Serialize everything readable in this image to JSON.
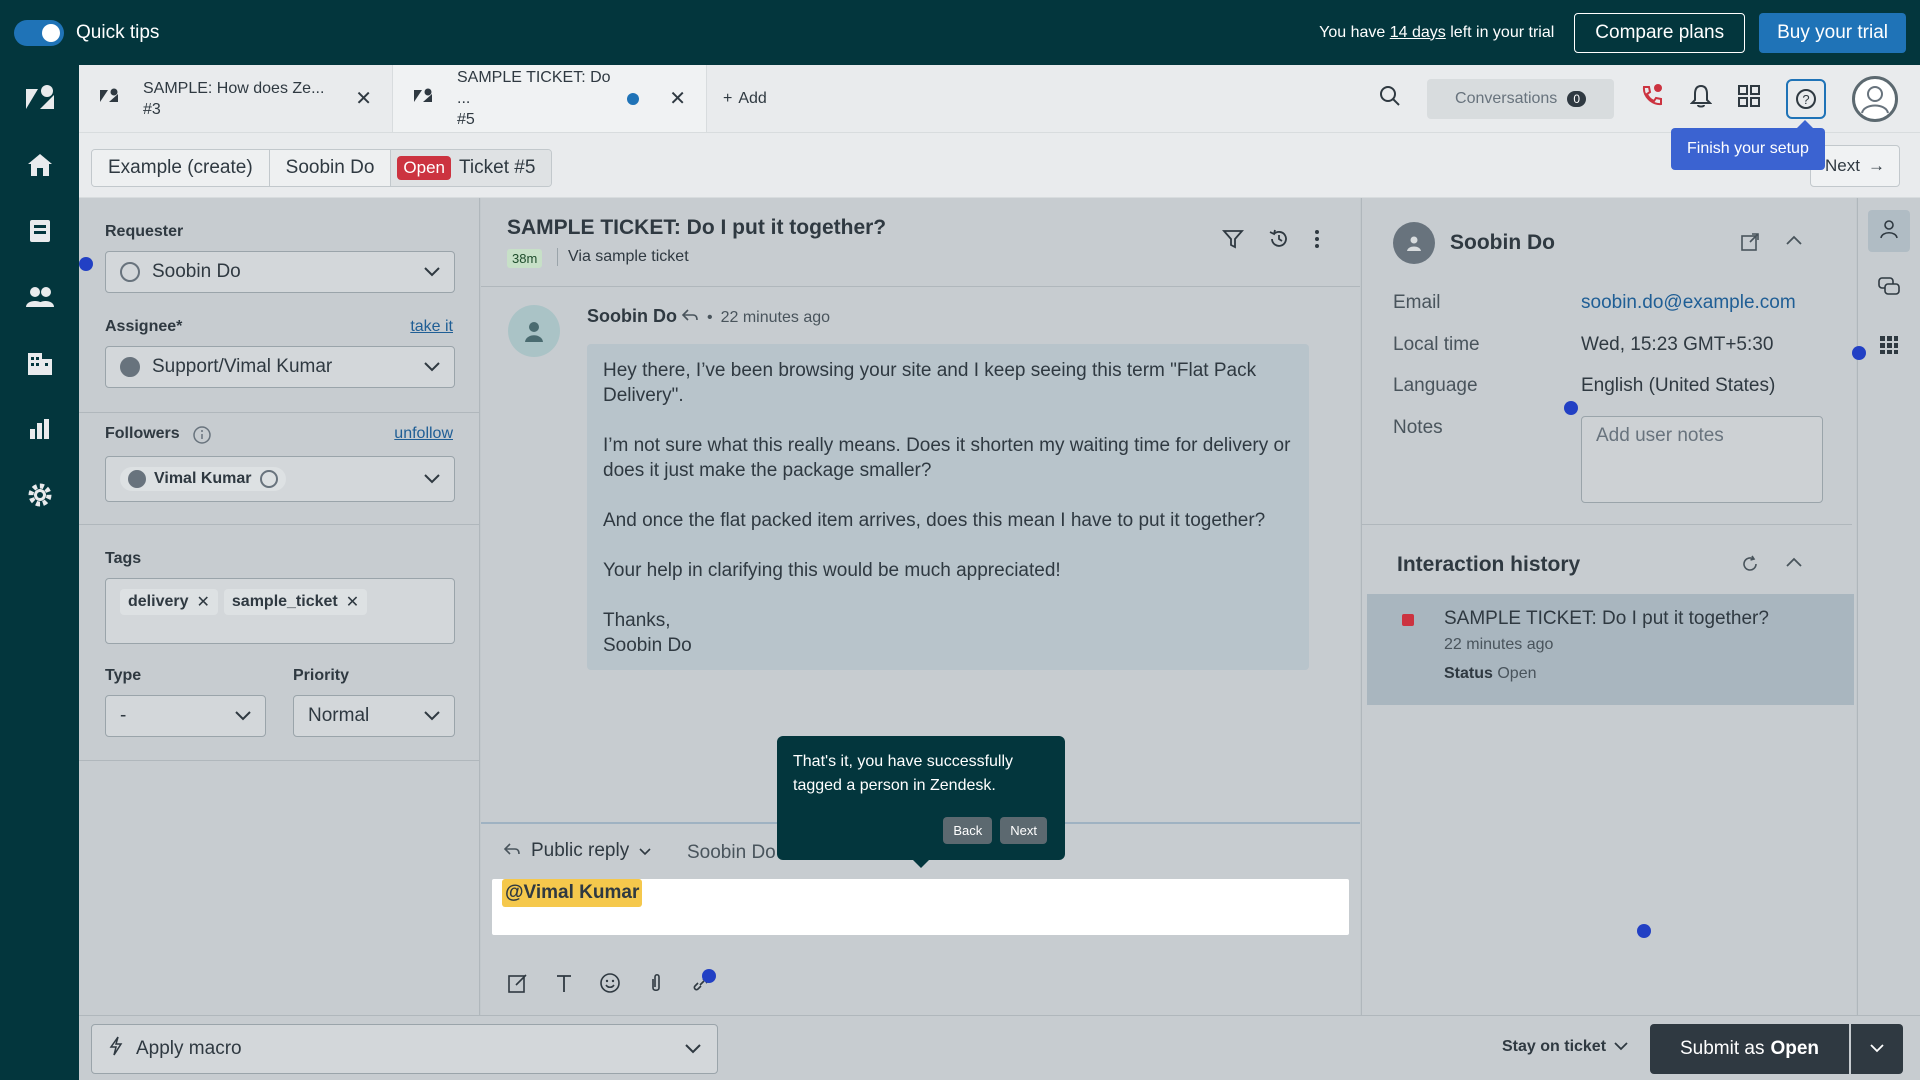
{
  "topbar": {
    "quick_tips": "Quick tips",
    "trial_prefix": "You have ",
    "trial_days": "14 days",
    "trial_suffix": " left in your trial",
    "compare_plans": "Compare plans",
    "buy_trial": "Buy your trial"
  },
  "tabs": [
    {
      "title": "SAMPLE: How does Ze...",
      "number": "#3"
    },
    {
      "title": "SAMPLE TICKET: Do ...",
      "number": "#5"
    }
  ],
  "add_tab": "Add",
  "conversations": {
    "label": "Conversations",
    "count": "0"
  },
  "finish_setup": "Finish your setup",
  "breadcrumb": {
    "item1": "Example (create)",
    "item2": "Soobin Do",
    "status": "Open",
    "ticket": "Ticket #5"
  },
  "next_label": "Next",
  "properties": {
    "requester_label": "Requester",
    "requester_value": "Soobin Do",
    "assignee_label": "Assignee*",
    "take_it": "take it",
    "assignee_value": "Support/Vimal Kumar",
    "followers_label": "Followers",
    "unfollow": "unfollow",
    "follower": "Vimal Kumar",
    "tags_label": "Tags",
    "tags": [
      "delivery",
      "sample_ticket"
    ],
    "type_label": "Type",
    "type_value": "-",
    "priority_label": "Priority",
    "priority_value": "Normal"
  },
  "conversation": {
    "title": "SAMPLE TICKET: Do I put it together?",
    "age": "38m",
    "via": "Via sample ticket",
    "author": "Soobin Do",
    "time": "22 minutes ago",
    "paragraphs": [
      "Hey there, I’ve been browsing your site and I keep seeing this term \"Flat Pack Delivery\".",
      "I’m not sure what this really means. Does it shorten my waiting time for delivery or does it just make the package smaller?",
      "And once the flat packed item arrives, does this mean I have to put it together?",
      "Your help in clarifying this would be much appreciated!"
    ],
    "signoff": "Thanks,",
    "signoff_name": "Soobin Do"
  },
  "composer": {
    "mode": "Public reply",
    "to": "Soobin Do",
    "mention": "@Vimal Kumar"
  },
  "tooltip": {
    "text": "That's it, you have successfully tagged a person in Zendesk.",
    "back": "Back",
    "next": "Next"
  },
  "customer": {
    "name": "Soobin Do",
    "email_label": "Email",
    "email": "soobin.do@example.com",
    "localtime_label": "Local time",
    "localtime": "Wed, 15:23 GMT+5:30",
    "language_label": "Language",
    "language": "English (United States)",
    "notes_label": "Notes",
    "notes_placeholder": "Add user notes"
  },
  "interaction_history": {
    "title": "Interaction history",
    "item_title": "SAMPLE TICKET: Do I put it together?",
    "item_time": "22 minutes ago",
    "status_label": "Status",
    "status_value": "Open"
  },
  "bottombar": {
    "apply_macro": "Apply macro",
    "stay_on_ticket": "Stay on ticket",
    "submit_prefix": "Submit as",
    "submit_status": "Open"
  }
}
